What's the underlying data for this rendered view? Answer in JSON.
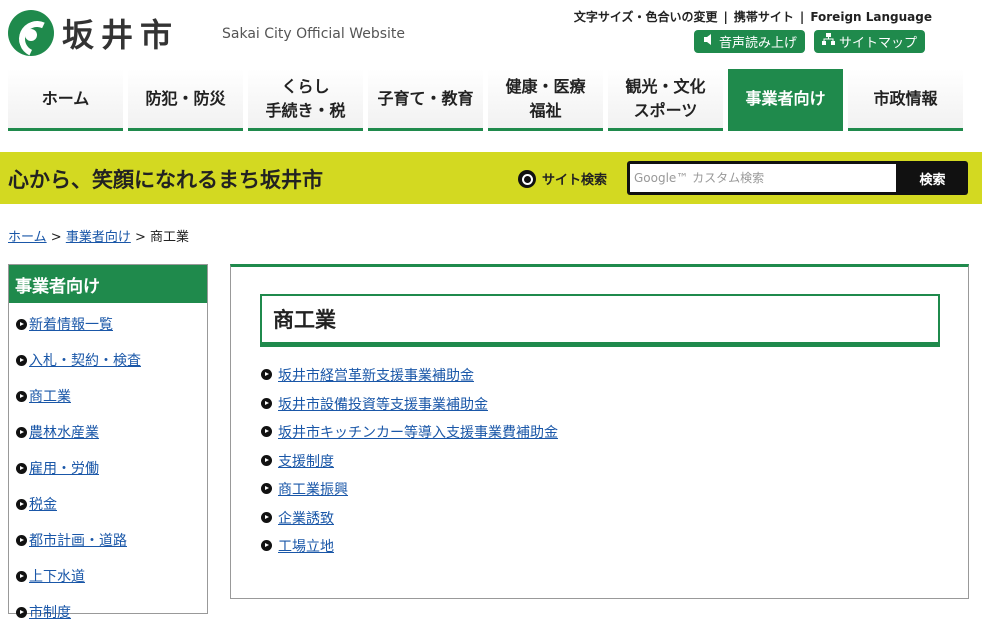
{
  "header": {
    "site_title": "坂井市",
    "site_subtitle": "Sakai City Official Website",
    "util_links": [
      "文字サイズ・色合いの変更",
      "携帯サイト",
      "Foreign Language"
    ],
    "util_separator": "|",
    "voice_button": "音声読み上げ",
    "sitemap_button": "サイトマップ"
  },
  "gnav": [
    {
      "line1": "ホーム",
      "line2": "",
      "active": false
    },
    {
      "line1": "防犯・防災",
      "line2": "",
      "active": false
    },
    {
      "line1": "くらし",
      "line2": "手続き・税",
      "active": false
    },
    {
      "line1": "子育て・教育",
      "line2": "",
      "active": false
    },
    {
      "line1": "健康・医療",
      "line2": "福祉",
      "active": false
    },
    {
      "line1": "観光・文化",
      "line2": "スポーツ",
      "active": false
    },
    {
      "line1": "事業者向け",
      "line2": "",
      "active": true
    },
    {
      "line1": "市政情報",
      "line2": "",
      "active": false
    }
  ],
  "banner": {
    "tagline": "心から、笑顔になれるまち坂井市",
    "site_search_label": "サイト検索",
    "search_placeholder": "Google™ カスタム検索",
    "search_button": "検索"
  },
  "breadcrumb": {
    "home": "ホーム",
    "sep": ">",
    "parent": "事業者向け",
    "current": "商工業"
  },
  "sidebar": {
    "heading": "事業者向け",
    "items": [
      "新着情報一覧",
      "入札・契約・検査",
      "商工業",
      "農林水産業",
      "雇用・労働",
      "税金",
      "都市計画・道路",
      "上下水道",
      "市制度"
    ]
  },
  "main": {
    "title": "商工業",
    "links": [
      "坂井市経営革新支援事業補助金",
      "坂井市設備投資等支援事業補助金",
      "坂井市キッチンカー等導入支援事業費補助金",
      "支援制度",
      "商工業振興",
      "企業誘致",
      "工場立地"
    ]
  },
  "colors": {
    "brand_green": "#1f8a4c",
    "banner_yellow": "#d3d921",
    "link_blue": "#1a57a8"
  }
}
